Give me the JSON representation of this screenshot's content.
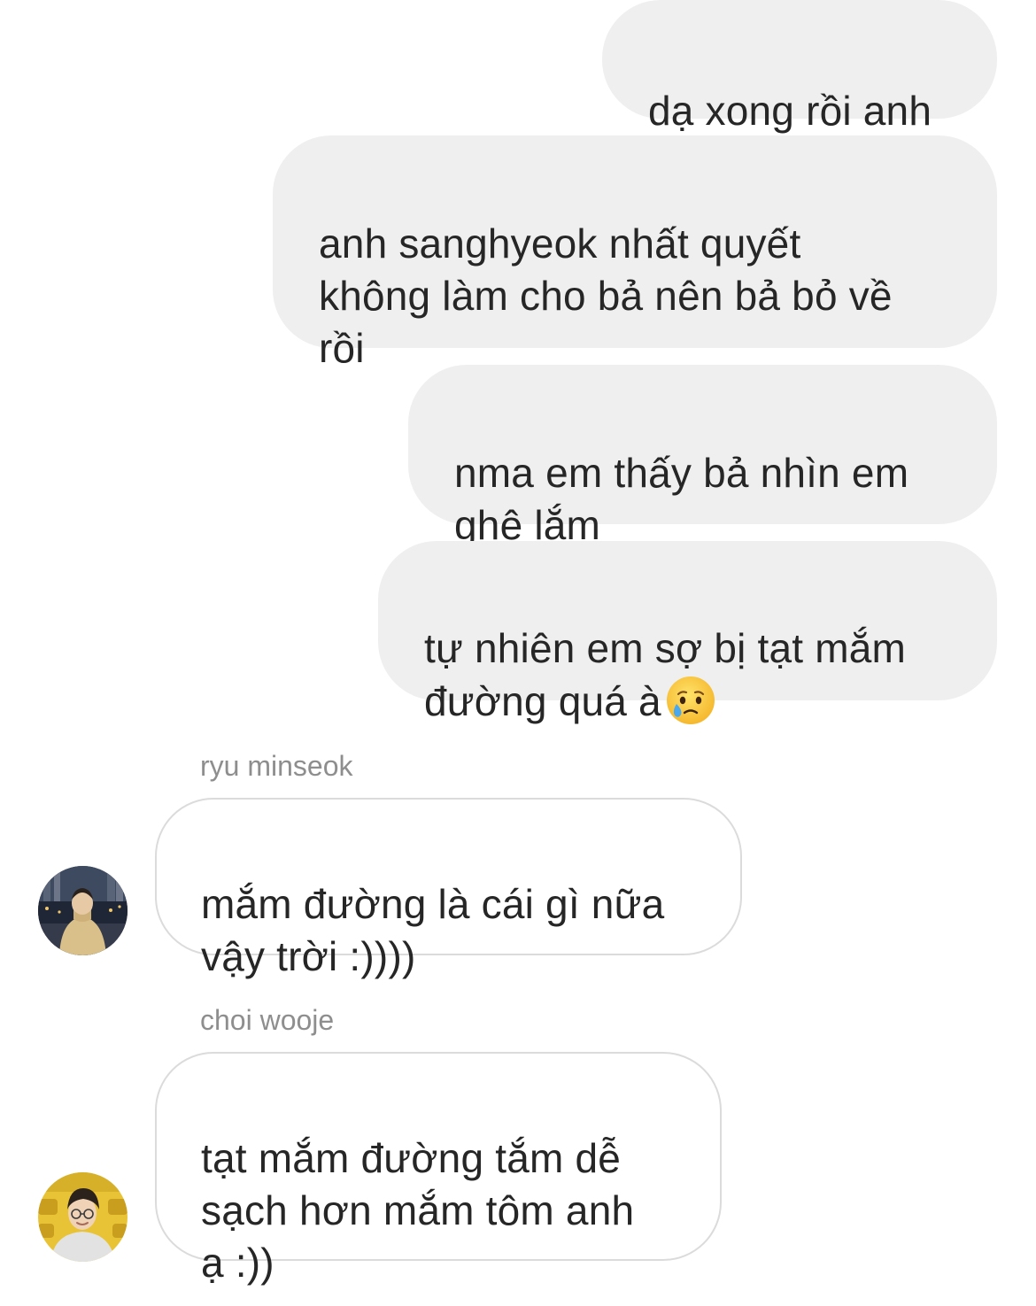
{
  "conversation": {
    "outgoing": [
      {
        "text": "dạ xong rồi anh"
      },
      {
        "text": "anh sanghyeok nhất quyết\nkhông làm cho bả nên bả bỏ về\nrồi"
      },
      {
        "text": "nma em thấy bả nhìn em\nghê lắm"
      },
      {
        "text": "tự nhiên em sợ bị tạt mắm\nđường quá à",
        "emoji": "face-holding-back-tears"
      }
    ],
    "incoming": [
      {
        "sender": "ryu minseok",
        "text": "mắm đường là cái gì nữa\nvậy trời :))))",
        "avatar": "photo-person-night-city"
      },
      {
        "sender": "choi wooje",
        "text": "tạt mắm đường tắm dễ\nsạch hơn mắm tôm anh\nạ :))",
        "avatar": "photo-person-yellow-seats"
      }
    ]
  },
  "colors": {
    "outgoing_bubble": "#efefef",
    "incoming_border": "#dbdbdb",
    "text": "#262626",
    "sender_name": "#8e8e8e",
    "background": "#ffffff"
  }
}
